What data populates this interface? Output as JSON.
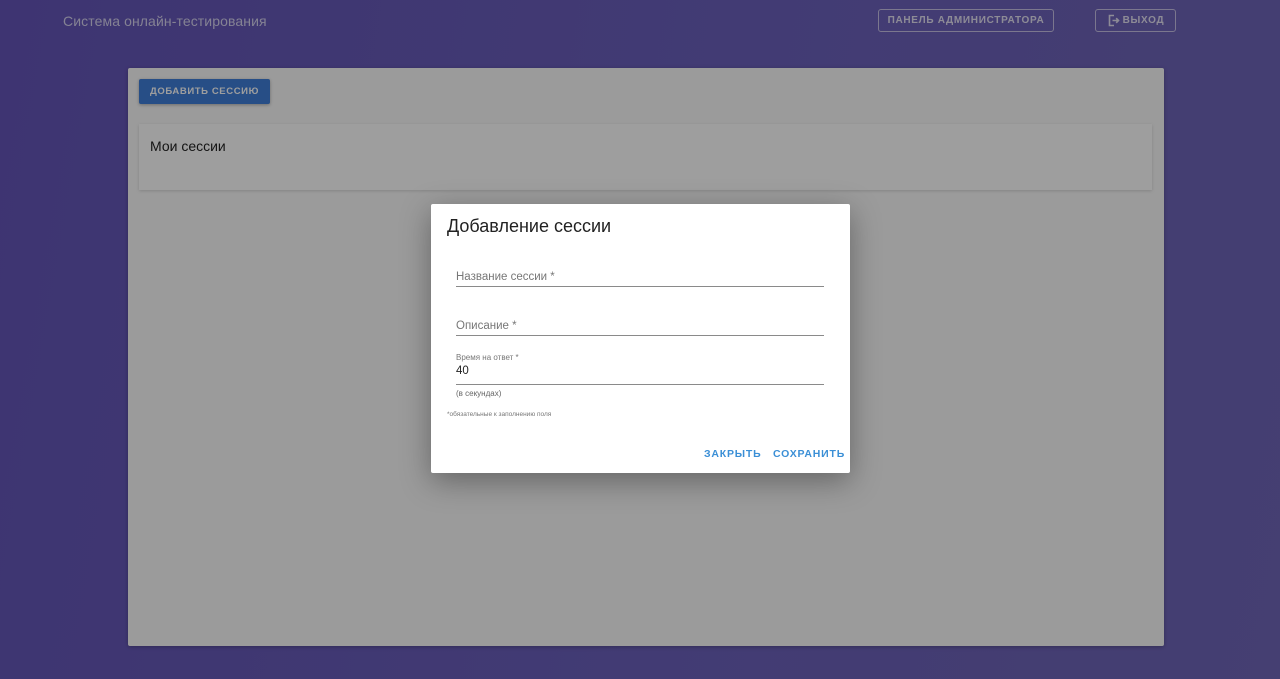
{
  "header": {
    "app_title": "Система онлайн-тестирования",
    "admin_panel_label": "ПАНЕЛЬ АДМИНИСТРАТОРА",
    "logout_label": "ВЫХОД",
    "logout_icon": "logout-icon"
  },
  "main": {
    "add_session_label": "ДОБАВИТЬ СЕССИЮ",
    "sessions_title": "Мои сессии"
  },
  "dialog": {
    "title": "Добавление сессии",
    "name_field": {
      "placeholder": "Название сессии *",
      "value": ""
    },
    "description_field": {
      "placeholder": "Описание *",
      "value": ""
    },
    "time_field": {
      "label": "Время на ответ *",
      "value": "40",
      "helper": "(в секундах)"
    },
    "required_note": "*обязательные к заполнению поля",
    "close_label": "ЗАКРЫТЬ",
    "save_label": "СОХРАНИТЬ"
  },
  "colors": {
    "background": "#6455b8",
    "primary_button": "#3f7ed8",
    "dialog_action": "#3b8fd6"
  }
}
